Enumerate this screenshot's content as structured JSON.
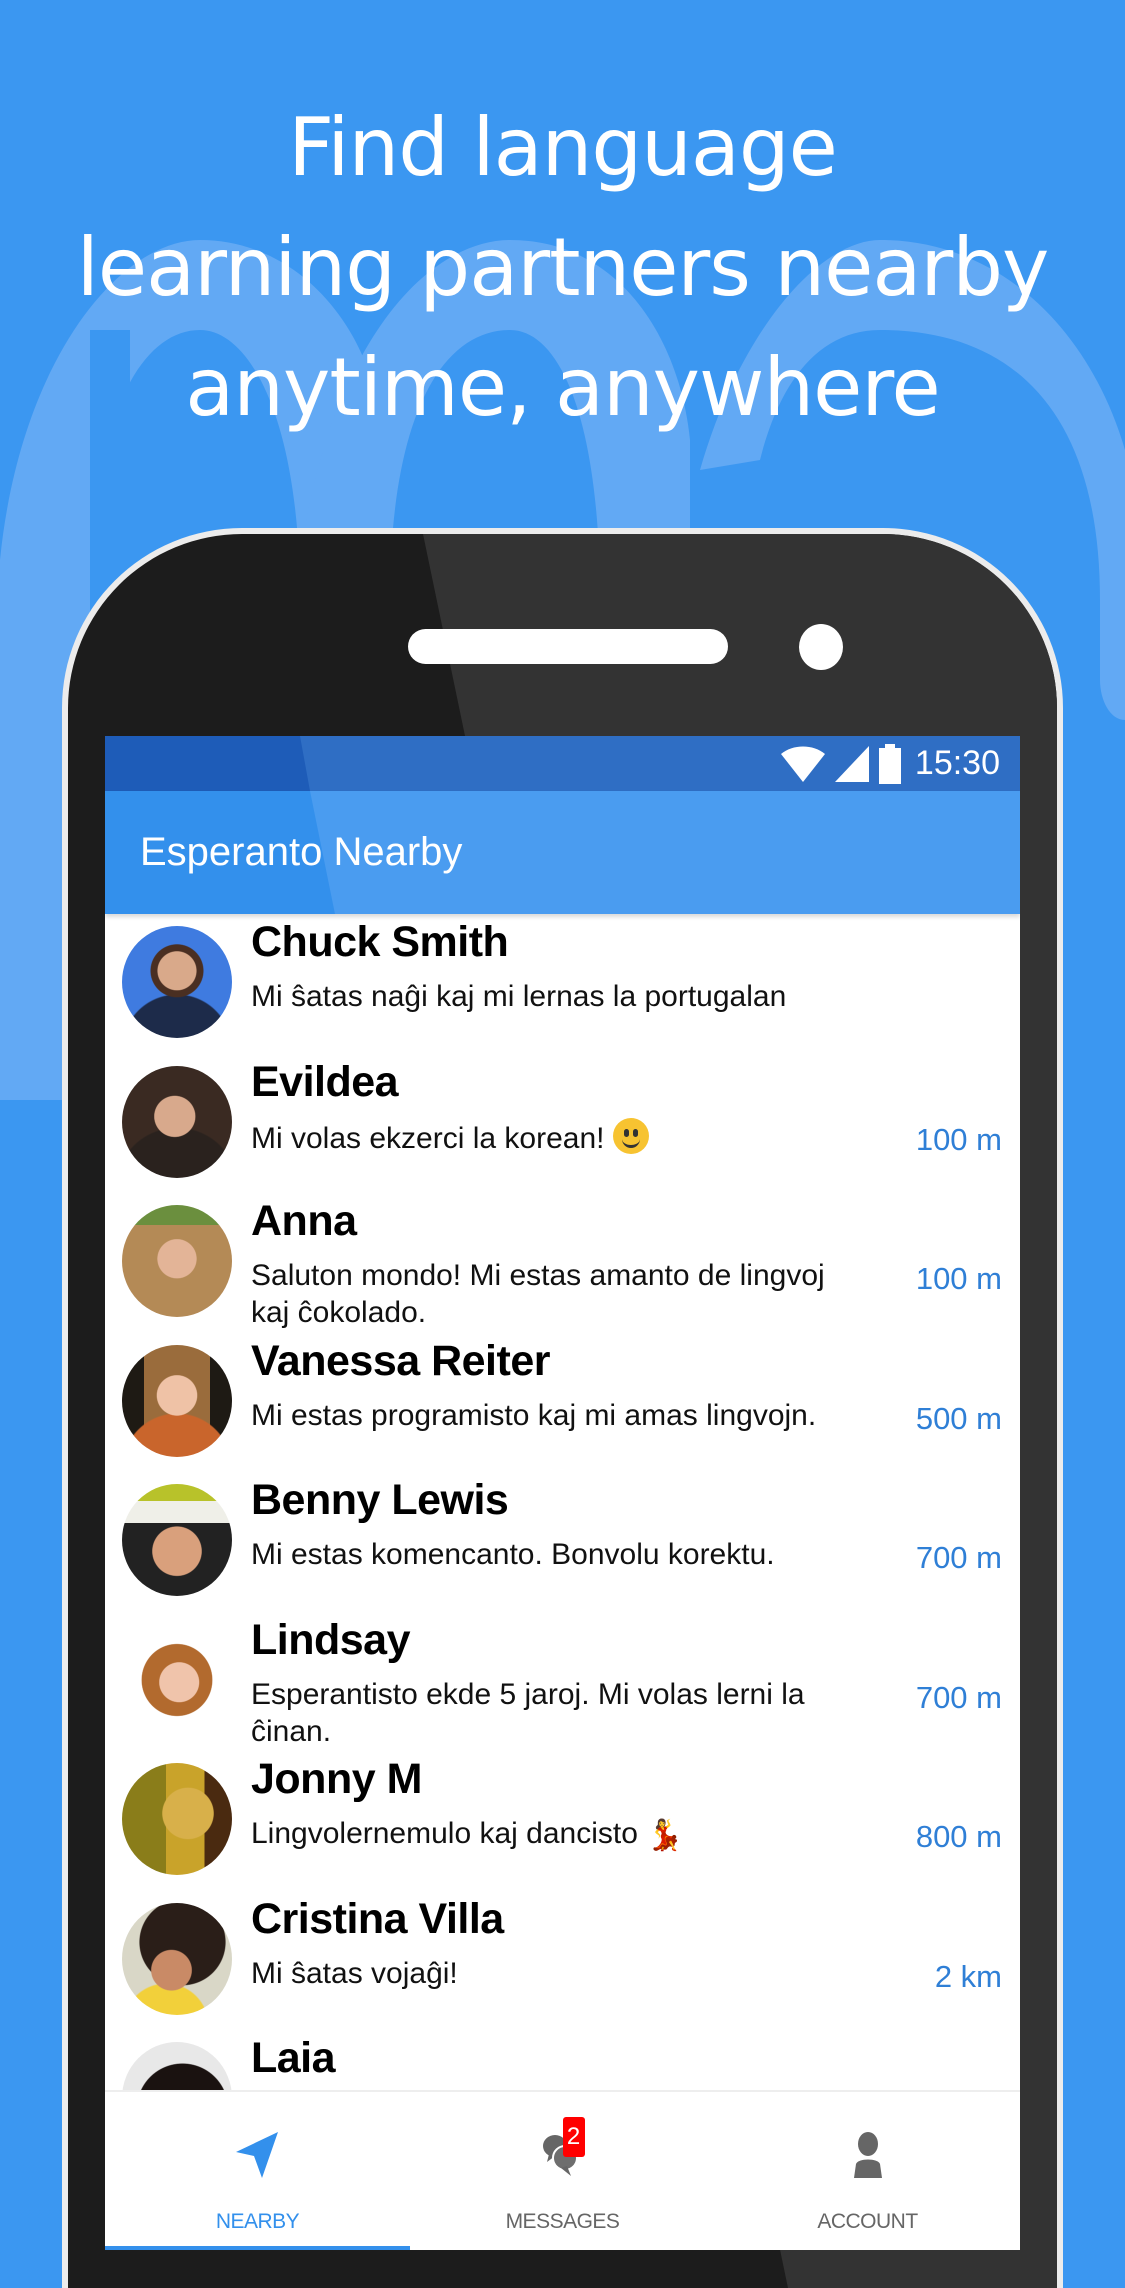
{
  "promo": {
    "headline_lines": [
      "Find language",
      "learning partners nearby",
      "anytime, anywhere"
    ]
  },
  "colors": {
    "background": "#3b97f1",
    "accent": "#3390ec",
    "distance": "#2f7fd6",
    "badge": "#ff0000"
  },
  "status_bar": {
    "icons": [
      "wifi-icon",
      "signal-icon",
      "battery-icon"
    ],
    "time": "15:30"
  },
  "app_bar": {
    "title": "Esperanto Nearby"
  },
  "users": [
    {
      "name": "Chuck Smith",
      "message": "Mi ŝatas naĝi kaj mi lernas la portugalan",
      "distance": "",
      "emoji": ""
    },
    {
      "name": "Evildea",
      "message": "Mi volas ekzerci la korean! ",
      "distance": "100 m",
      "emoji": "smiling-face"
    },
    {
      "name": "Anna",
      "message": "Saluton mondo! Mi estas amanto de lingvoj kaj ĉokolado.",
      "distance": "100 m",
      "emoji": ""
    },
    {
      "name": "Vanessa Reiter",
      "message": "Mi estas programisto kaj mi amas lingvojn.",
      "distance": "500 m",
      "emoji": ""
    },
    {
      "name": "Benny Lewis",
      "message": "Mi estas komencanto. Bonvolu korektu.",
      "distance": "700 m",
      "emoji": ""
    },
    {
      "name": "Lindsay",
      "message": "Esperantisto ekde 5 jaroj. Mi volas lerni la ĉinan.",
      "distance": "700 m",
      "emoji": ""
    },
    {
      "name": "Jonny M",
      "message": "Lingvolernemulo kaj dancisto ",
      "distance": "800 m",
      "emoji": "dancer"
    },
    {
      "name": "Cristina Villa",
      "message": "Mi ŝatas vojaĝi!",
      "distance": "2 km",
      "emoji": ""
    },
    {
      "name": "Laia",
      "message": "",
      "distance": "",
      "emoji": ""
    }
  ],
  "bottom_nav": {
    "items": [
      {
        "label": "NEARBY",
        "icon": "navigation-arrow-icon",
        "active": true
      },
      {
        "label": "MESSAGES",
        "icon": "chat-bubbles-icon",
        "badge": "2",
        "active": false
      },
      {
        "label": "ACCOUNT",
        "icon": "person-icon",
        "active": false
      }
    ]
  }
}
